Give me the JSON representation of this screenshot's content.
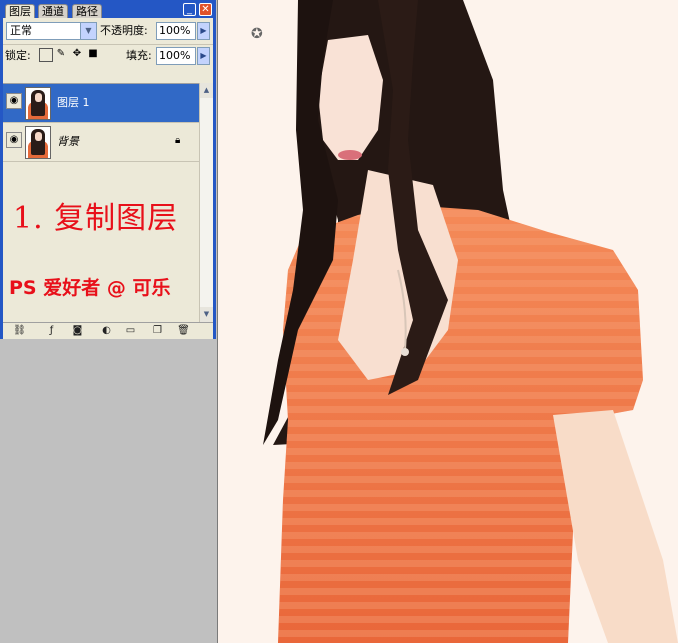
{
  "panel": {
    "tabs": [
      "图层",
      "通道",
      "路径"
    ],
    "blend_mode": "正常",
    "opacity_label": "不透明度:",
    "opacity_value": "100%",
    "lock_label": "锁定:",
    "fill_label": "填充:",
    "fill_value": "100%",
    "layers": [
      {
        "name": "图层 1",
        "selected": true
      },
      {
        "name": "背景",
        "selected": false,
        "locked": true
      }
    ],
    "minimize_icon": "minimize-icon",
    "close_icon": "close-icon"
  },
  "tutorial": {
    "step": "1. 复制图层",
    "credit": "PS 爱好者 @ 可乐"
  },
  "colors": {
    "panel_title": "#2457c5",
    "selected_layer": "#3169c6",
    "annotation_red": "#e8101a",
    "canvas_bg": "#fdf3ec",
    "shirt": "#f07848"
  }
}
